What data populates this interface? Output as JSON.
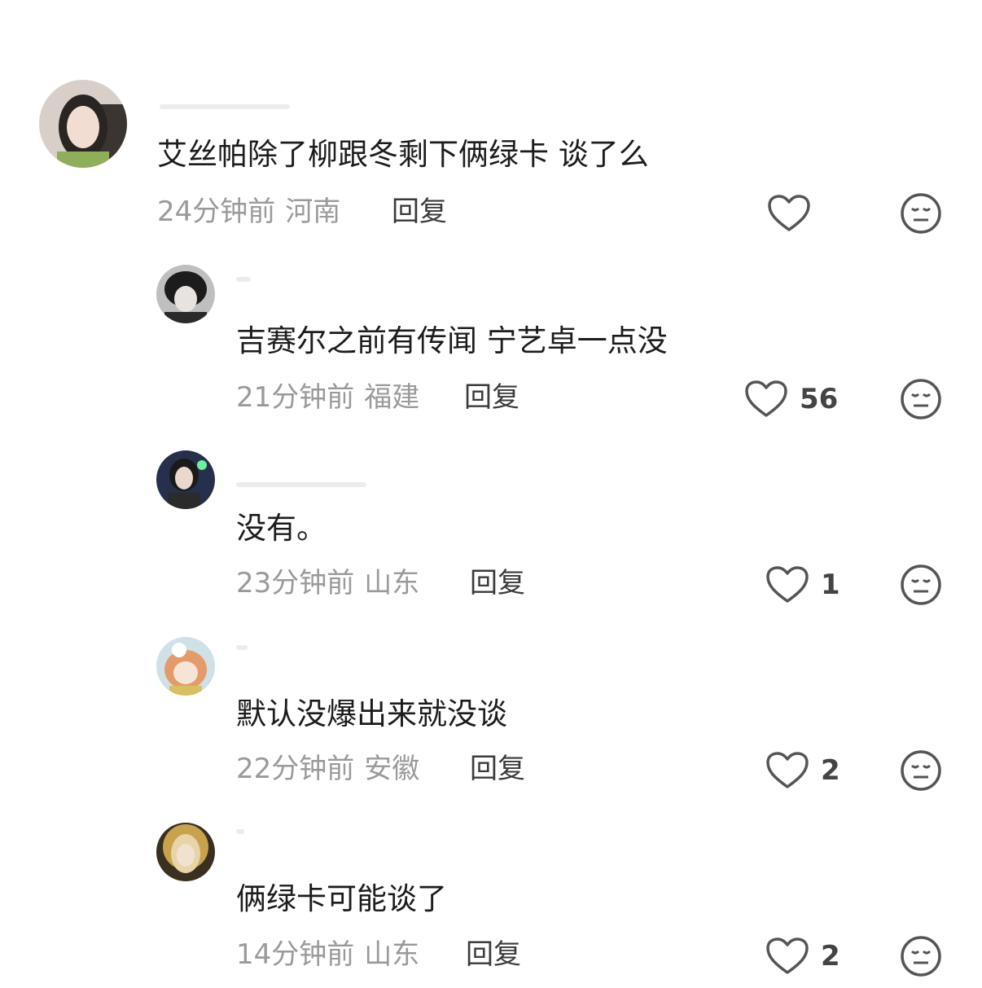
{
  "comments": [
    {
      "text": "艾丝帕除了柳跟冬剩下俩绿卡 谈了么",
      "time": "24分钟前",
      "location": "河南",
      "reply_label": "回复",
      "likes": "",
      "like_icon": "heart-outline-icon",
      "dislike_icon": "meh-face-icon"
    },
    {
      "text": "吉赛尔之前有传闻  宁艺卓一点没",
      "time": "21分钟前",
      "location": "福建",
      "reply_label": "回复",
      "likes": "56",
      "like_icon": "heart-outline-icon",
      "dislike_icon": "meh-face-icon"
    },
    {
      "text": "没有。",
      "time": "23分钟前",
      "location": "山东",
      "reply_label": "回复",
      "likes": "1",
      "like_icon": "heart-outline-icon",
      "dislike_icon": "meh-face-icon"
    },
    {
      "text": "默认没爆出来就没谈",
      "time": "22分钟前",
      "location": "安徽",
      "reply_label": "回复",
      "likes": "2",
      "like_icon": "heart-outline-icon",
      "dislike_icon": "meh-face-icon"
    },
    {
      "text": "俩绿卡可能谈了",
      "time": "14分钟前",
      "location": "山东",
      "reply_label": "回复",
      "likes": "2",
      "like_icon": "heart-outline-icon",
      "dislike_icon": "meh-face-icon"
    }
  ],
  "colors": {
    "meta_gray": "#9a9a9a",
    "icon_gray": "#555555",
    "text_dark": "#1c1c1c"
  }
}
